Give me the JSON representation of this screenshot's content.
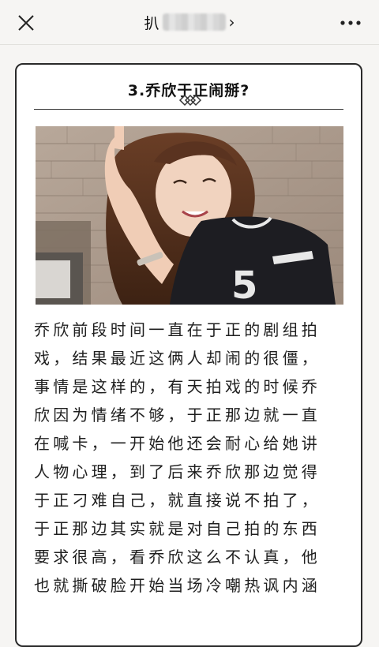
{
  "header": {
    "title_prefix": "扒",
    "title_chevron": "›",
    "close_icon": "close-icon",
    "more_icon": "more-icon"
  },
  "article": {
    "heading": "3.乔欣于正闹掰?",
    "lines": [
      "乔欣前段时间一直在于正的剧组拍",
      "戏，结果最近这俩人却闹的很僵，",
      "事情是这样的，有天拍戏的时候乔",
      "欣因为情绪不够，于正那边就一直",
      "在喊卡，一开始他还会耐心给她讲",
      "人物心理，到了后来乔欣那边觉得",
      "于正刁难自己，就直接说不拍了，",
      "于正那边其实就是对自己拍的东西",
      "要求很高，看乔欣这么不认真，他",
      "也就撕破脸开始当场冷嘲热讽内涵"
    ]
  },
  "colors": {
    "background": "#f6f5f3",
    "card_border": "#2a2a2a",
    "text": "#1f1f1f"
  }
}
